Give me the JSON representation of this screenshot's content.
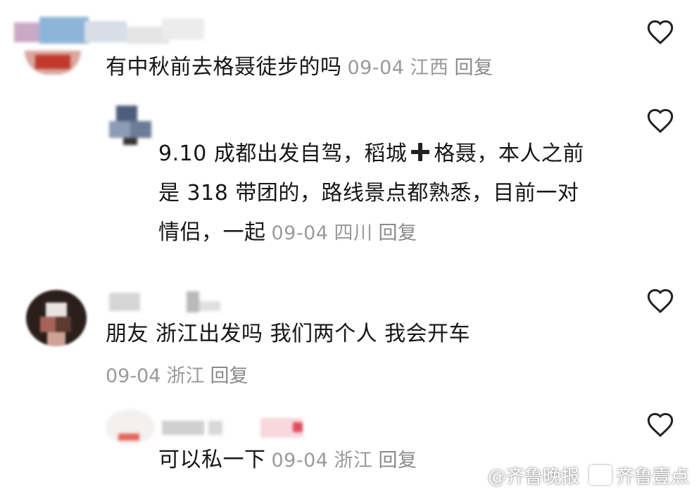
{
  "comments": [
    {
      "text": "有中秋前去格聂徒步的吗",
      "date": "09-04",
      "location": "江西",
      "reply": "回复"
    },
    {
      "line1a": "9.10 成都出发自驾，稻城",
      "line1b": "格聂，本人之前",
      "line2": "是 318 带团的，路线景点都熟悉，目前一对",
      "line3": "情侣，一起",
      "date": "09-04",
      "location": "四川",
      "reply": "回复"
    },
    {
      "text": "朋友 浙江出发吗 我们两个人  我会开车",
      "date": "09-04",
      "location": "浙江",
      "reply": "回复"
    },
    {
      "text": "可以私一下",
      "date": "09-04",
      "location": "浙江",
      "reply": "回复"
    }
  ],
  "watermark": {
    "left": "@齐鲁晚报",
    "right": "齐鲁壹点"
  },
  "icons": {
    "like": "heart-outline-icon",
    "plus": "plus-icon"
  },
  "colors": {
    "text": "#161616",
    "meta": "#9a9a9a"
  }
}
